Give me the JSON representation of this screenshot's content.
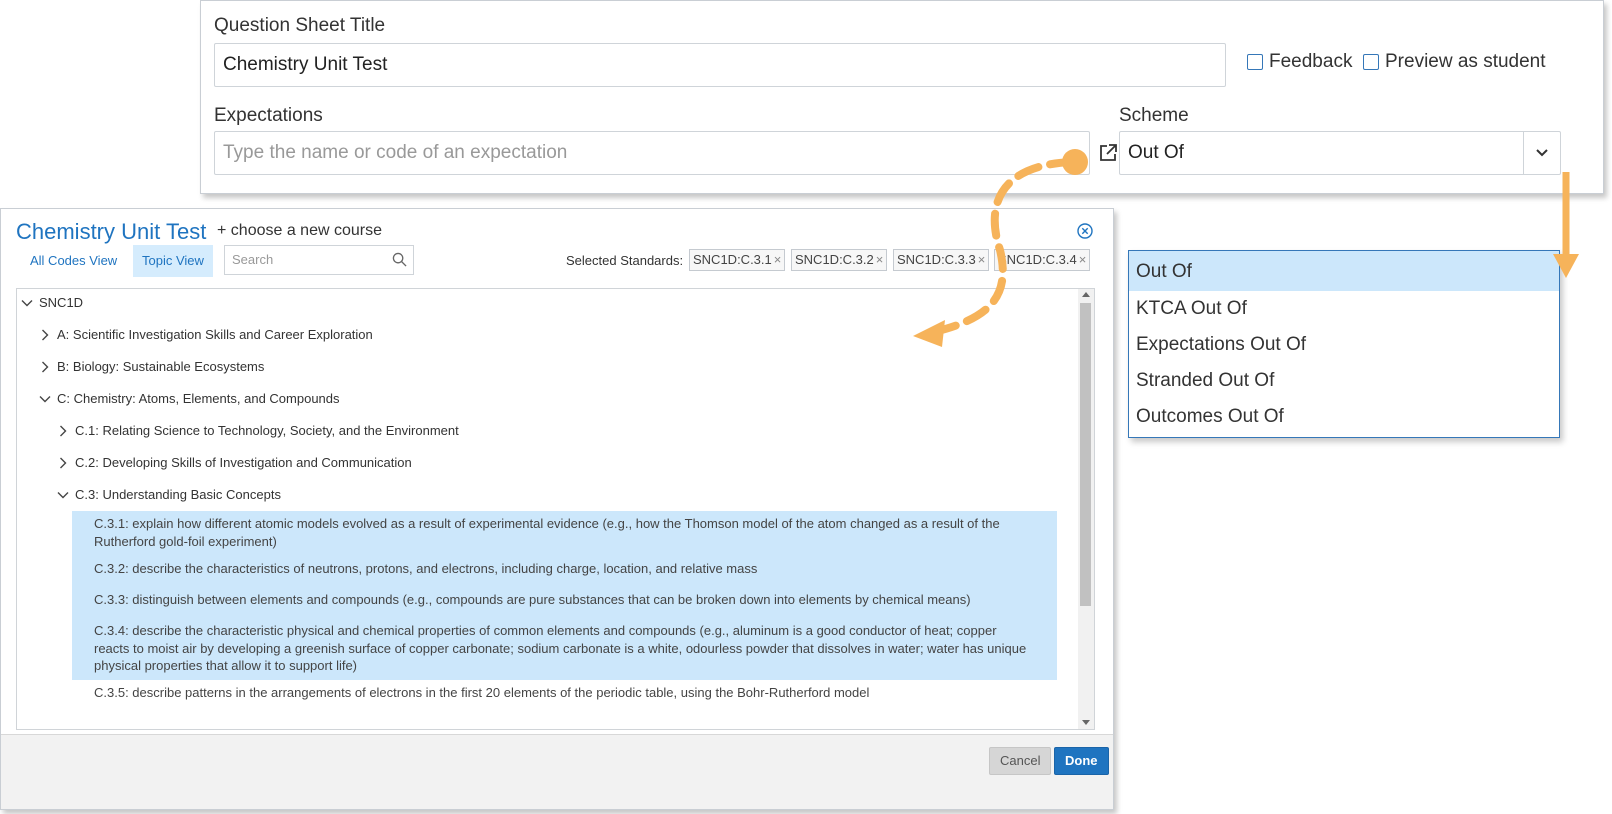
{
  "form": {
    "title_label": "Question Sheet Title",
    "title_value": "Chemistry Unit Test",
    "feedback_label": "Feedback",
    "preview_label": "Preview as student",
    "expectations_label": "Expectations",
    "expectations_placeholder": "Type the name or code of an expectation",
    "scheme_label": "Scheme",
    "scheme_value": "Out Of"
  },
  "dropdown": {
    "options": [
      "Out Of",
      "KTCA Out Of",
      "Expectations Out Of",
      "Stranded Out Of",
      "Outcomes Out Of"
    ],
    "selected_index": 0
  },
  "modal": {
    "title": "Chemistry Unit Test",
    "choose_course": "+ choose a new course",
    "tabs": [
      "All Codes View",
      "Topic View"
    ],
    "active_tab": "Topic View",
    "search_placeholder": "Search",
    "selected_label": "Selected Standards:",
    "selected_chips": [
      "SNC1D:C.3.1",
      "SNC1D:C.3.2",
      "SNC1D:C.3.3",
      "SNC1D:C.3.4"
    ],
    "tree": {
      "root": "SNC1D",
      "strands": [
        "A: Scientific Investigation Skills and Career Exploration",
        "B: Biology: Sustainable Ecosystems",
        "C: Chemistry: Atoms, Elements, and Compounds"
      ],
      "substrands": [
        "C.1: Relating Science to Technology, Society, and the Environment",
        "C.2: Developing Skills of Investigation and Communication",
        "C.3: Understanding Basic Concepts"
      ],
      "expectations": [
        {
          "text": "C.3.1: explain how different atomic models evolved as a result of experimental evidence (e.g., how the Thomson model of the atom changed as a result of the Rutherford gold-foil experiment)",
          "selected": true
        },
        {
          "text": "C.3.2: describe the characteristics of neutrons, protons, and electrons, including charge, location, and relative mass",
          "selected": true
        },
        {
          "text": "C.3.3: distinguish between elements and compounds (e.g., compounds are pure substances that can be broken down into elements by chemical means)",
          "selected": true
        },
        {
          "text": "C.3.4: describe the characteristic physical and chemical properties of common elements and compounds (e.g., aluminum is a good conductor of heat; copper reacts to moist air by developing a greenish surface of copper carbonate; sodium carbonate is a white, odourless powder that dissolves in water; water has unique physical properties that allow it to support life)",
          "selected": true
        },
        {
          "text": "C.3.5: describe patterns in the arrangements of electrons in the first 20 elements of the periodic table, using the Bohr-Rutherford model",
          "selected": false
        }
      ]
    },
    "cancel_label": "Cancel",
    "done_label": "Done"
  },
  "colors": {
    "accent": "#1f74c0",
    "selection": "#cce7fb",
    "annotation_arrow": "#f6b35a"
  },
  "icons": [
    "external-link-icon",
    "chevron-down-icon",
    "close-circle-icon",
    "search-icon",
    "chevron-right-icon"
  ]
}
